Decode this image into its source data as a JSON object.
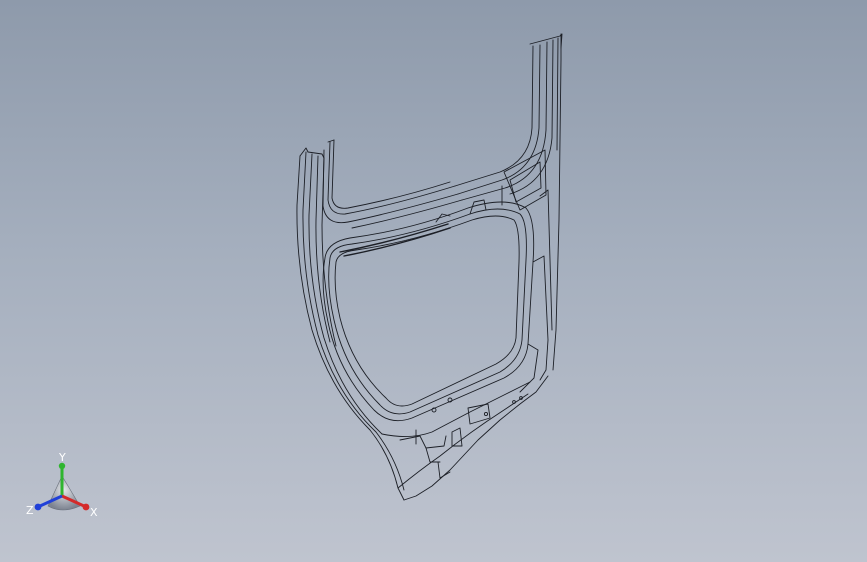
{
  "viewport": {
    "background_top": "#8e9aab",
    "background_bottom": "#bfc4cf",
    "model_line_color": "#1c1f26"
  },
  "triad": {
    "x_label": "X",
    "y_label": "Y",
    "z_label": "Z",
    "x_color": "#d42a2a",
    "y_color": "#2fb52f",
    "z_color": "#2040d8"
  }
}
